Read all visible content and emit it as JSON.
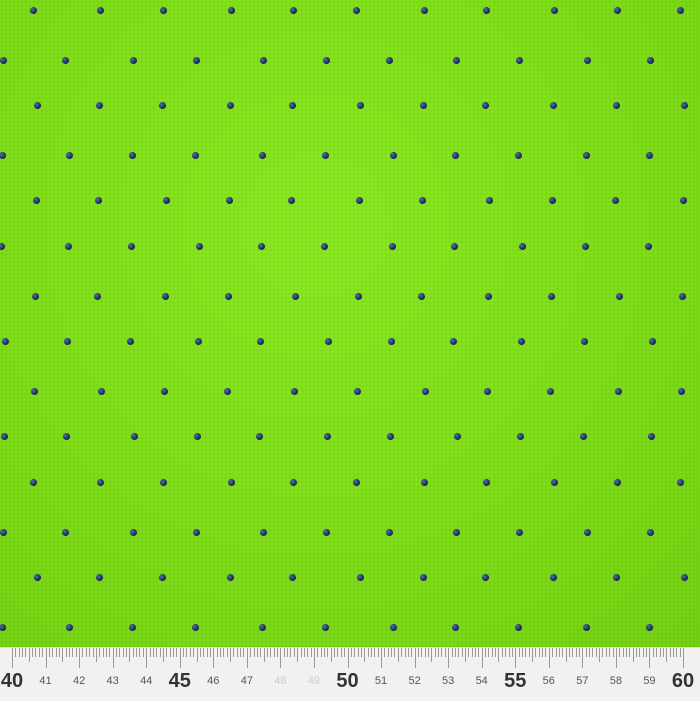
{
  "image": {
    "subject": "fabric-with-sequin-dots",
    "colors": {
      "fabric": "#7fe01a",
      "dot": "#122246",
      "ruler": "#f1f2f0"
    }
  },
  "ruler": {
    "unit_labels": [
      "40",
      "41",
      "42",
      "43",
      "44",
      "45",
      "46",
      "47",
      "48",
      "49",
      "50",
      "51",
      "52",
      "53",
      "54",
      "55",
      "56",
      "57",
      "58",
      "59",
      "60"
    ]
  }
}
